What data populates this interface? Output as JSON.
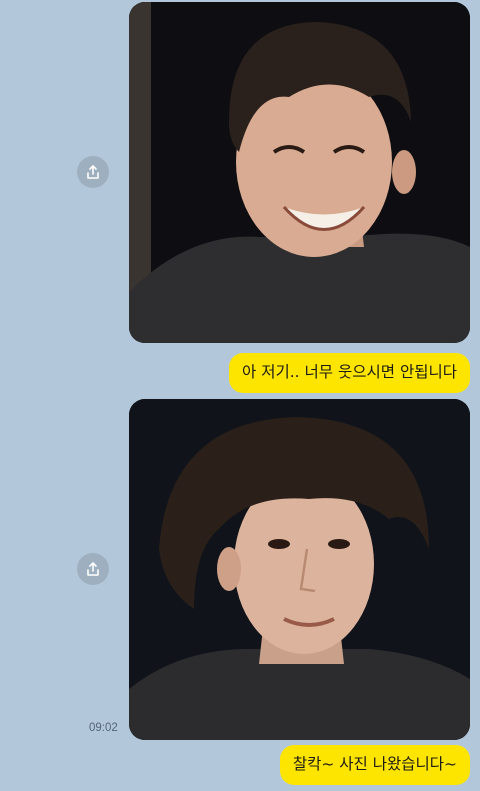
{
  "chat": {
    "messages": [
      {
        "type": "photo",
        "description": "selfie-smiling"
      },
      {
        "type": "text",
        "text": "아 저기.. 너무 웃으시면 안됩니다"
      },
      {
        "type": "photo",
        "description": "selfie-posing"
      },
      {
        "type": "text",
        "text": "찰칵~ 사진 나왔습니다~"
      }
    ],
    "timestamp": "09:02"
  },
  "icons": {
    "share": "share-icon"
  },
  "colors": {
    "background": "#b2c7d9",
    "my_bubble": "#fee500",
    "share_button": "#9eb0bf"
  }
}
